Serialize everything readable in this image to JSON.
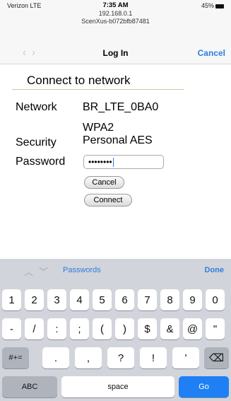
{
  "status": {
    "carrier": "Verizon LTE",
    "time": "7:35 AM",
    "ip": "192.168.0.1",
    "ssid": "ScenXus-b072bfb87481",
    "battery": "45%"
  },
  "nav": {
    "title": "Log In",
    "cancel": "Cancel"
  },
  "form": {
    "heading": "Connect to network",
    "network_label": "Network",
    "network_value": "BR_LTE_0BA0",
    "security_label": "Security",
    "security_line1": "WPA2",
    "security_line2": "Personal AES",
    "password_label": "Password",
    "password_value": "••••••••",
    "cancel_button": "Cancel",
    "connect_button": "Connect"
  },
  "keyboard_bar": {
    "passwords": "Passwords",
    "done": "Done"
  },
  "keyboard": {
    "row1": [
      "1",
      "2",
      "3",
      "4",
      "5",
      "6",
      "7",
      "8",
      "9",
      "0"
    ],
    "row2": [
      "-",
      "/",
      ":",
      ";",
      "(",
      ")",
      "$",
      "&",
      "@",
      "\""
    ],
    "row3": {
      "shift": "#+=",
      "keys": [
        ".",
        ",",
        "?",
        "!",
        "'"
      ]
    },
    "row4": {
      "abc": "ABC",
      "space": "space",
      "go": "Go"
    }
  }
}
